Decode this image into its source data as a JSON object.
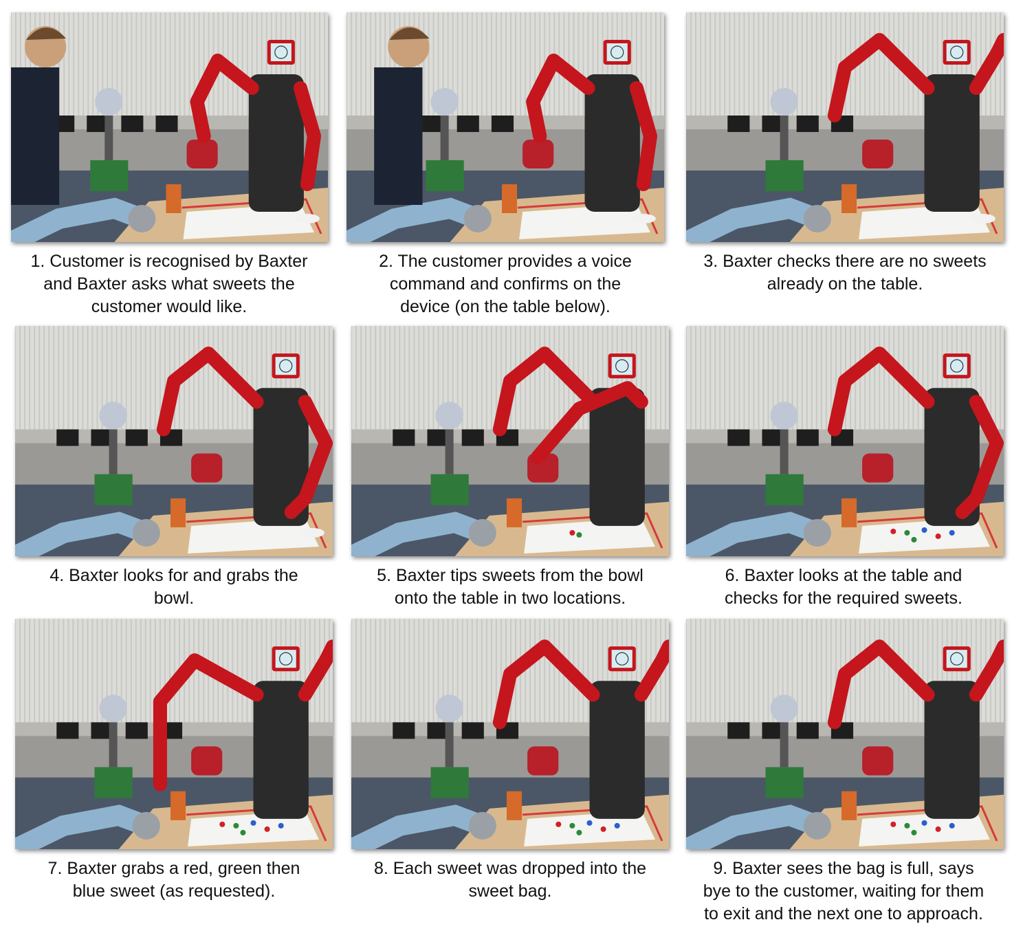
{
  "colors": {
    "robot_red": "#c4161c",
    "robot_dark": "#2b2b2b",
    "screen_face": "#d7ecf2",
    "table_wood": "#d8b98f",
    "paper": "#f4f4f2",
    "tape": "#d63a3a",
    "wall": "#b9b7b1",
    "window": "#dcdcd8",
    "carpet": "#4b5766",
    "ur_arm": "#8fb3cf",
    "chair_red": "#b8202a"
  },
  "panels": [
    {
      "caption": "1. Customer is recognised by Baxter\nand Baxter asks what sweets the\ncustomer would like.",
      "scene": {
        "person": true,
        "person_bent": false,
        "left_arm": "up",
        "right_arm": "down",
        "sweets": "none"
      }
    },
    {
      "caption": "2. The customer provides a voice\ncommand and confirms on the\ndevice (on the table below).",
      "scene": {
        "person": true,
        "person_bent": true,
        "left_arm": "up",
        "right_arm": "down",
        "sweets": "none"
      }
    },
    {
      "caption": "3. Baxter checks there are no sweets\nalready on the table.",
      "scene": {
        "person": false,
        "left_arm": "over",
        "right_arm": "up",
        "sweets": "bowl"
      }
    },
    {
      "caption": "4. Baxter looks for and grabs the\nbowl.",
      "scene": {
        "person": false,
        "left_arm": "over",
        "right_arm": "grab",
        "sweets": "bowl"
      }
    },
    {
      "caption": "5. Baxter tips sweets from the bowl\nonto the table in two locations.",
      "scene": {
        "person": false,
        "left_arm": "over",
        "right_arm": "tip",
        "sweets": "few"
      }
    },
    {
      "caption": "6. Baxter looks at the table and\nchecks for the required sweets.",
      "scene": {
        "person": false,
        "left_arm": "over",
        "right_arm": "grab",
        "sweets": "scattered"
      }
    },
    {
      "caption": "7. Baxter grabs a red, green then\nblue sweet (as requested).",
      "scene": {
        "person": false,
        "left_arm": "down",
        "right_arm": "up",
        "sweets": "scattered"
      }
    },
    {
      "caption": "8. Each sweet was dropped into the\nsweet bag.",
      "scene": {
        "person": false,
        "left_arm": "over",
        "right_arm": "up",
        "sweets": "scattered"
      }
    },
    {
      "caption": "9. Baxter sees the bag is full, says\nbye to the customer, waiting for them\nto exit and the next one to approach.",
      "scene": {
        "person": false,
        "left_arm": "over",
        "right_arm": "up",
        "sweets": "scattered"
      }
    }
  ]
}
